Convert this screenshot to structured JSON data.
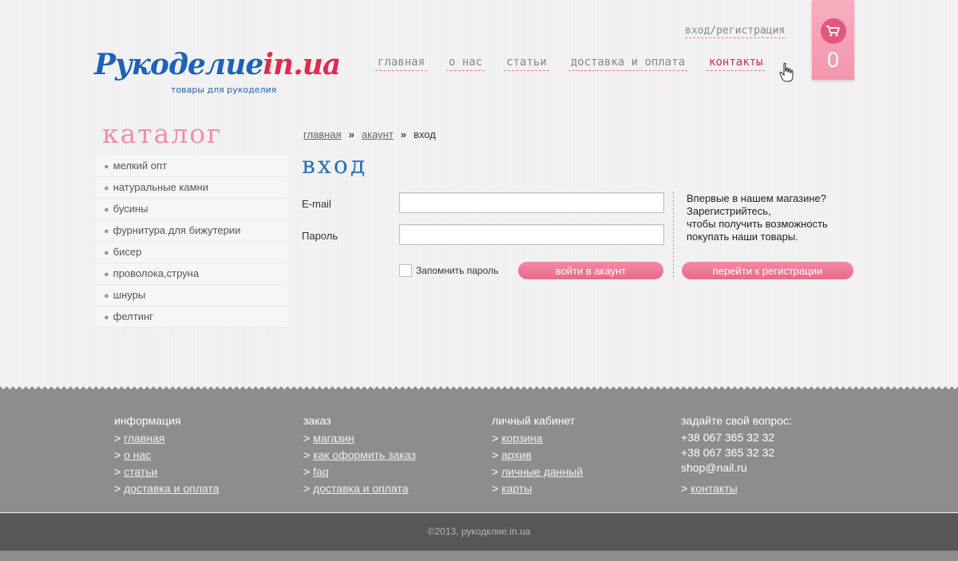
{
  "header": {
    "logo_text_main": "Рукоделие",
    "logo_text_accent": "in.ua",
    "logo_tagline": "товары для рукоделия",
    "login_link": "вход/регистрация",
    "nav": [
      {
        "label": "главная"
      },
      {
        "label": "о нас"
      },
      {
        "label": "статьи"
      },
      {
        "label": "доставка и оплата"
      },
      {
        "label": "контакты",
        "active": true
      }
    ],
    "cart_count": "0"
  },
  "sidebar": {
    "title": "каталог",
    "items": [
      {
        "label": "мелкий опт"
      },
      {
        "label": "натуральные камни"
      },
      {
        "label": "бусины"
      },
      {
        "label": "фурнитура для бижутерии"
      },
      {
        "label": "бисер"
      },
      {
        "label": "проволока,струна"
      },
      {
        "label": "шнуры"
      },
      {
        "label": "фелтинг"
      }
    ]
  },
  "breadcrumb": {
    "items": [
      "главная",
      "акаунт",
      "вход"
    ],
    "separator": "»"
  },
  "login_form": {
    "title": "вход",
    "email_label": "E-mail",
    "email_value": "",
    "password_label": "Пароль",
    "password_value": "",
    "remember_label": "Запомнить пароль",
    "remember_checked": false,
    "submit_label": "войти в акаунт"
  },
  "register": {
    "text_lines": [
      "Впервые в нашем магазине?",
      "Зарегистрийтесь,",
      "чтобы получить возможность",
      "покупать наши товары."
    ],
    "button_label": "перейти к регистрации"
  },
  "footer": {
    "columns": [
      {
        "title": "информация",
        "links": [
          "главная",
          "о нас",
          "статьи",
          "доставка и оплата"
        ]
      },
      {
        "title": "заказ",
        "links": [
          "магазин",
          "как оформить заказ",
          "faq",
          "доставка и оплата"
        ]
      },
      {
        "title": "личный кабинет",
        "links": [
          "корзина",
          "архив",
          "личные данный",
          "карты"
        ]
      }
    ],
    "contact": {
      "title": "задайте свой вопрос:",
      "phones": [
        "+38 067 365 32 32",
        "+38 067 365 32 32"
      ],
      "email": "shop@nail.ru",
      "link": "контакты"
    },
    "copyright": "©2013, рукодклие.in.ua"
  },
  "colors": {
    "accent_pink": "#e86a89",
    "brand_blue": "#1e63b4",
    "footer_bg": "#8e8d8d",
    "bottom_bg": "#575757"
  }
}
